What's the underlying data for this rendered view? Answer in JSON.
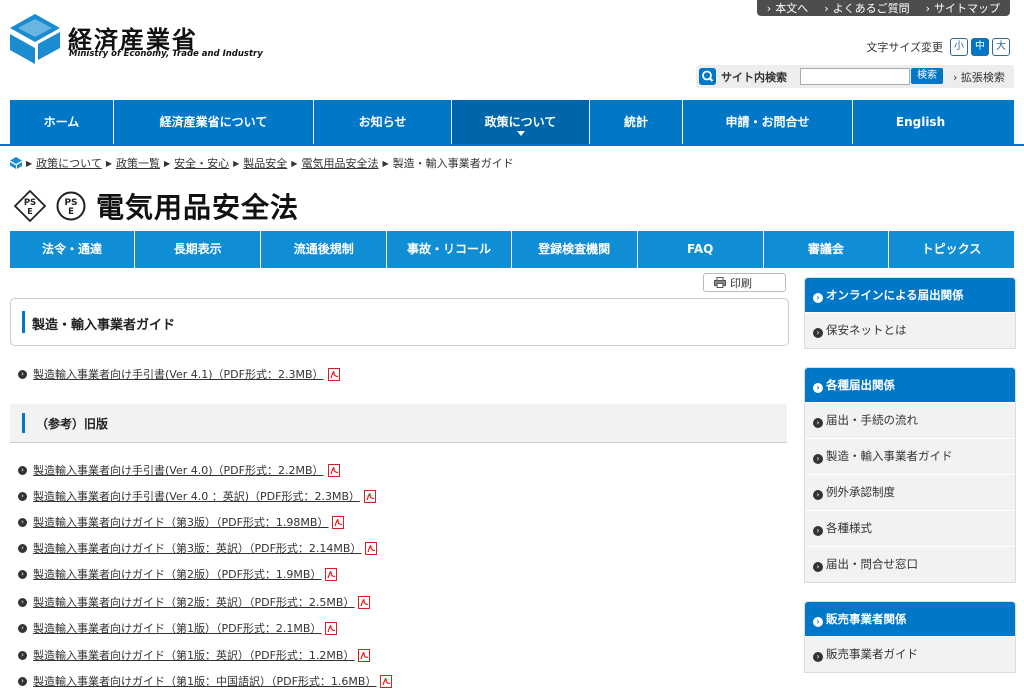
{
  "top_links": [
    "本文へ",
    "よくあるご質問",
    "サイトマップ"
  ],
  "logo": {
    "ja": "経済産業省",
    "en": "Ministry of Economy, Trade and Industry"
  },
  "font_size": {
    "label": "文字サイズ変更",
    "small": "小",
    "medium": "中",
    "large": "大"
  },
  "search": {
    "label": "サイト内検索",
    "value": "",
    "button": "検索",
    "extended": "拡張検索"
  },
  "global_nav": [
    "ホーム",
    "経済産業省について",
    "お知らせ",
    "政策について",
    "統計",
    "申請・お問合せ",
    "English"
  ],
  "breadcrumb": [
    "政策について",
    "政策一覧",
    "安全・安心",
    "製品安全",
    "電気用品安全法",
    "製造・輸入事業者ガイド"
  ],
  "page_title": "電気用品安全法",
  "ps_marks": {
    "diamond": "PS\nE",
    "round": "PS\nE"
  },
  "sub_nav": [
    "法令・通達",
    "長期表示",
    "流通後規制",
    "事故・リコール",
    "登録検査機関",
    "FAQ",
    "審議会",
    "トピックス"
  ],
  "print_label": "印刷",
  "main": {
    "heading": "製造・輸入事業者ガイド",
    "current_doc": "製造輸入事業者向け手引書(Ver 4.1)（PDF形式：2.3MB）",
    "old_heading": "（参考）旧版",
    "old_docs": [
      "製造輸入事業者向け手引書(Ver 4.0)（PDF形式：2.2MB）",
      "製造輸入事業者向け手引書(Ver 4.0 ：英訳)（PDF形式：2.3MB）",
      "製造輸入事業者向けガイド（第3版）（PDF形式：1.98MB）",
      "製造輸入事業者向けガイド（第3版：英訳）（PDF形式：2.14MB）",
      "製造輸入事業者向けガイド（第2版）（PDF形式：1.9MB）",
      "製造輸入事業者向けガイド（第2版：英訳）（PDF形式：2.5MB）",
      "製造輸入事業者向けガイド（第1版）（PDF形式：2.1MB）",
      "製造輸入事業者向けガイド（第1版：英訳）（PDF形式：1.2MB）",
      "製造輸入事業者向けガイド（第1版：中国語訳）（PDF形式：1.6MB）"
    ]
  },
  "sidebar": {
    "online": {
      "title": "オンラインによる届出関係",
      "items": [
        "保安ネットとは"
      ]
    },
    "notifications": {
      "title": "各種届出関係",
      "items": [
        "届出・手続の流れ",
        "製造・輸入事業者ガイド",
        "例外承認制度",
        "各種様式",
        "届出・問合せ窓口"
      ]
    },
    "sales": {
      "title": "販売事業者関係",
      "items": [
        "販売事業者ガイド"
      ]
    }
  },
  "colors": {
    "primary": "#0077c7",
    "subnav": "#0f8ed6",
    "pdf": "#d92020"
  }
}
